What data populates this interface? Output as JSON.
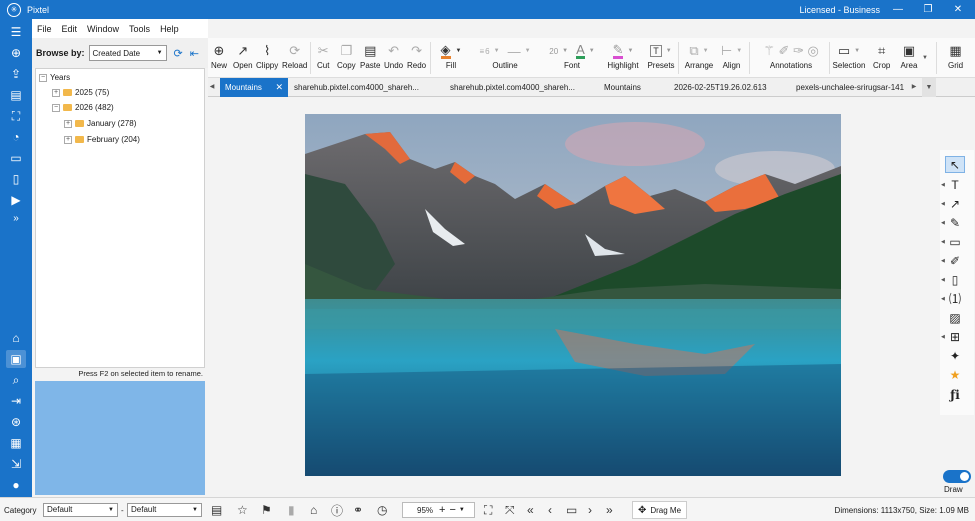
{
  "titlebar": {
    "app_title": "Pixtel",
    "license": "Licensed - Business",
    "min": "—",
    "max": "❐",
    "close": "✕"
  },
  "menu": [
    "File",
    "Edit",
    "Window",
    "Tools",
    "Help"
  ],
  "browse": {
    "label": "Browse by:",
    "value": "Created Date"
  },
  "tree": {
    "root": "Years",
    "items": [
      {
        "label": "2025 (75)",
        "level": 1
      },
      {
        "label": "2026 (482)",
        "level": 1
      },
      {
        "label": "January (278)",
        "level": 2
      },
      {
        "label": "February (204)",
        "level": 2
      }
    ]
  },
  "hint": "Press F2 on selected item to rename.",
  "toolbar": {
    "new": "New",
    "open": "Open",
    "clippy": "Clippy",
    "reload": "Reload",
    "cut": "Cut",
    "copy": "Copy",
    "paste": "Paste",
    "undo": "Undo",
    "redo": "Redo",
    "fill": "Fill",
    "outline": "Outline",
    "outline_size": "6",
    "font": "Font",
    "font_size": "20",
    "highlight": "Highlight",
    "presets": "Presets",
    "arrange": "Arrange",
    "align": "Align",
    "annotations": "Annotations",
    "selection": "Selection",
    "crop": "Crop",
    "area": "Area",
    "grid": "Grid"
  },
  "tabs": [
    "Mountains",
    "sharehub.pixtel.com4000_shareh...",
    "sharehub.pixtel.com4000_shareh...",
    "Mountains",
    "2026-02-25T19.26.02.613",
    "pexels-unchalee-srirugsar-141"
  ],
  "bottom": {
    "category_label": "Category",
    "category_value": "Default",
    "dash": "-",
    "second_value": "Default",
    "zoom": "95%",
    "drag_me": "Drag Me",
    "status": "Dimensions: 1113x750, Size: 1.09 MB"
  },
  "right_tools": {
    "draw_label": "Draw"
  },
  "colors": {
    "accent": "#1a73c9",
    "fill_swatch": "#e8822e",
    "font_swatch": "#2e9e5a",
    "highlight_swatch": "#d94fd1"
  }
}
